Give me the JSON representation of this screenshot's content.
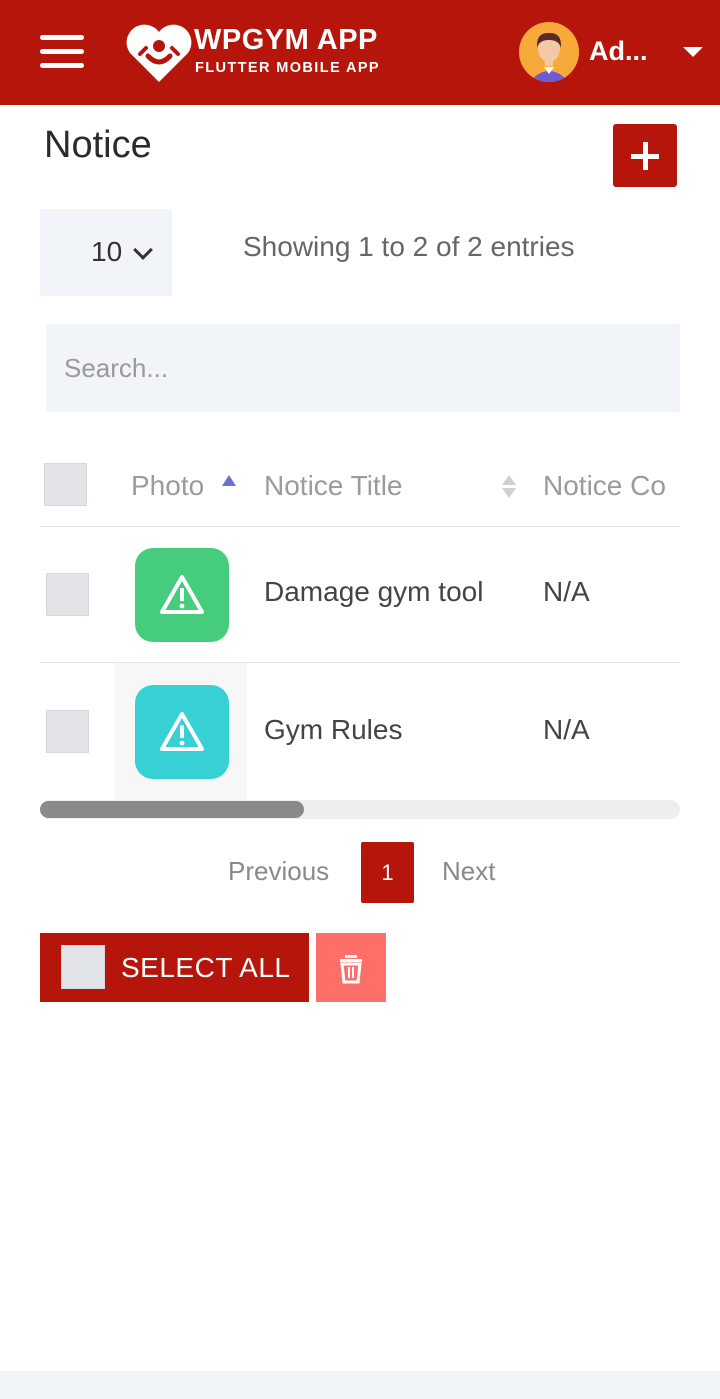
{
  "header": {
    "app_title": "WPGYM APP",
    "app_subtitle": "FLUTTER MOBILE APP",
    "user_name": "Ad...",
    "brand_color": "#b5150b"
  },
  "page": {
    "title": "Notice",
    "add_icon": "plus-icon"
  },
  "controls": {
    "page_length": "10",
    "entries_info": "Showing 1 to 2 of 2 entries",
    "search_placeholder": "Search..."
  },
  "table": {
    "columns": [
      "Photo",
      "Notice Title",
      "Notice Co"
    ],
    "rows": [
      {
        "icon": "warning-icon",
        "icon_color": "#45cc7c",
        "title": "Damage gym tool",
        "content": "N/A"
      },
      {
        "icon": "warning-icon",
        "icon_color": "#36d0d5",
        "title": "Gym Rules",
        "content": "N/A"
      }
    ]
  },
  "pagination": {
    "previous": "Previous",
    "current": "1",
    "next": "Next"
  },
  "bulk": {
    "select_all": "SELECT ALL",
    "delete_icon": "trash-icon",
    "delete_color": "#ff6f6a"
  }
}
